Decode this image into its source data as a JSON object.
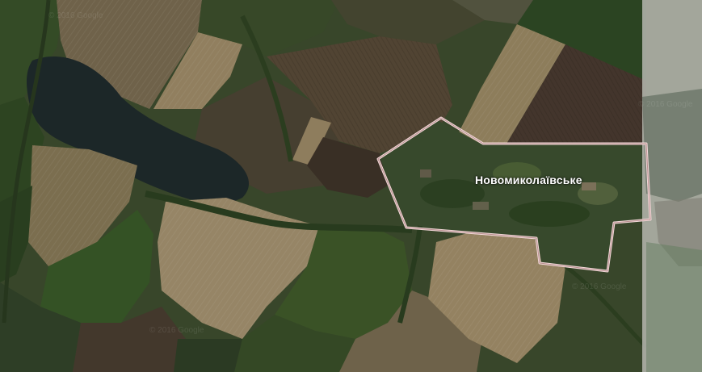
{
  "map": {
    "type": "satellite",
    "place_label": "Новомиколаївське",
    "watermark": "© 2016 Google",
    "boundary_color": "#f2d9d9",
    "colors": {
      "water": "#1f2b2e",
      "field_tan": "#8e7c5c",
      "field_green": "#3f5a2a",
      "field_brown": "#4a3b2e",
      "overlay_light": "#c9c9c1"
    }
  }
}
